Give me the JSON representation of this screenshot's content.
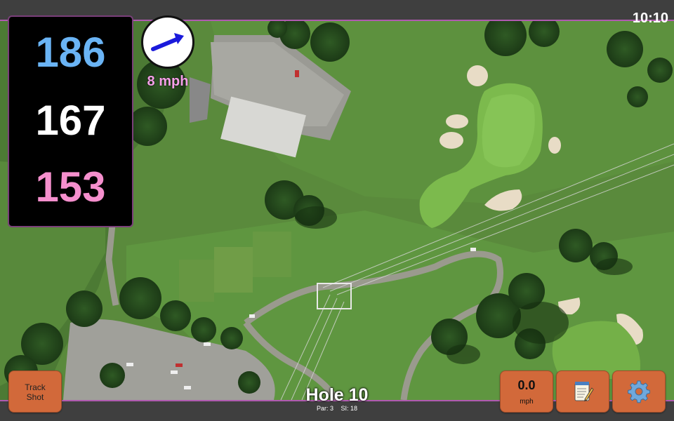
{
  "status": {
    "time": "10:10"
  },
  "distances": {
    "back": "186",
    "middle": "167",
    "front": "153"
  },
  "wind": {
    "speed_label": "8 mph",
    "icon": "wind-arrow-icon"
  },
  "hole": {
    "title": "Hole 10",
    "par": "Par: 3",
    "stroke_index": "SI: 18"
  },
  "buttons": {
    "track_shot": [
      "Track",
      "Shot"
    ],
    "speed_value": "0.0",
    "speed_unit": "mph",
    "notes_icon": "notepad-icon",
    "settings_icon": "gear-icon"
  },
  "colors": {
    "back_distance": "#6ab4f5",
    "middle_distance": "#ffffff",
    "front_distance": "#f58fcd",
    "button": "#d2693a",
    "accent": "#b05ab0"
  }
}
